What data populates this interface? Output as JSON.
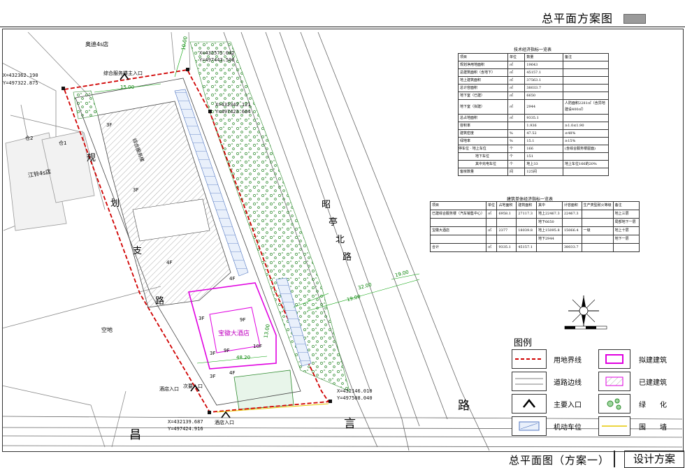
{
  "header": {
    "title": "总平面方案图"
  },
  "footer": {
    "title": "总平面图（方案一）",
    "box": "设计方案"
  },
  "tech_table": {
    "title": "技术经济指标一览表",
    "headers": [
      "项目",
      "单位",
      "数量",
      "备注"
    ],
    "rows": [
      [
        "规划净用地面积",
        "㎡",
        "19643",
        ""
      ],
      [
        "总建筑面积（含地下）",
        "㎡",
        "45157.1",
        ""
      ],
      [
        "地上建筑面积",
        "㎡",
        "37563.1",
        ""
      ],
      [
        "总计容面积",
        "㎡",
        "38033.7",
        ""
      ],
      [
        "地下室（已建）",
        "㎡",
        "6650",
        ""
      ],
      [
        "地下室（拟建）",
        "㎡",
        "2944",
        "人防面积2281㎡（含异地建设400㎡）"
      ],
      [
        "总占地面积",
        "㎡",
        "9335.1",
        ""
      ],
      [
        "容积率",
        "",
        "1.936",
        "≥1.0≤1.90"
      ],
      [
        "建筑密度",
        "%",
        "47.52",
        "≤48%"
      ],
      [
        "绿地率",
        "%",
        "15.1",
        "≥15%"
      ]
    ],
    "parking_label": "停车位",
    "parking_rows": [
      [
        "地上车位",
        "个",
        "166",
        "(含综合服务楼屋面)"
      ],
      [
        "地下车位",
        "个",
        "151",
        ""
      ],
      [
        "其中充电车位",
        "个",
        "地上33",
        "地上车位166的20%"
      ]
    ],
    "guest_row": [
      "客房数量",
      "间",
      "125间",
      ""
    ]
  },
  "building_table": {
    "title": "建筑单体经济指标一览表",
    "headers": [
      "项目",
      "单位",
      "占地面积",
      "建筑面积",
      "其中",
      "计容面积",
      "生产类型耐火等级",
      "备注"
    ],
    "rows": [
      [
        "已建综合服务楼（汽车销售中心）",
        "㎡",
        "6958.1",
        "27117.3",
        "地上22467.3",
        "22467.3",
        "",
        "地上三层"
      ],
      [
        "",
        "",
        "",
        "",
        "地下6650",
        "",
        "",
        "局部地下一层"
      ],
      [
        "宝徽大酒店",
        "㎡",
        "2377",
        "18039.8",
        "地上15095.8",
        "15066.4",
        "一级",
        "地上十层"
      ],
      [
        "",
        "",
        "",
        "",
        "地下2944",
        "",
        "",
        "地下一层"
      ],
      [
        "合计",
        "㎡",
        "9335.1",
        "45157.1",
        "",
        "38033.7",
        "",
        ""
      ]
    ]
  },
  "legend": {
    "title": "图例",
    "items": [
      {
        "label": "用地界线",
        "swatch": "boundary"
      },
      {
        "label": "拟建建筑",
        "swatch": "proposed"
      },
      {
        "label": "道路边线",
        "swatch": "road"
      },
      {
        "label": "已建建筑",
        "swatch": "existing"
      },
      {
        "label": "主要入口",
        "swatch": "entrance"
      },
      {
        "label": "绿　　化",
        "swatch": "green"
      },
      {
        "label": "机动车位",
        "swatch": "parking"
      },
      {
        "label": "围　　墙",
        "swatch": "wall"
      }
    ]
  },
  "map": {
    "roads": {
      "west": [
        "规",
        "划",
        "支",
        "路"
      ],
      "north_east": [
        "昭",
        "亭",
        "北",
        "路"
      ],
      "south": [
        "昌",
        "言",
        "路"
      ]
    },
    "labels": {
      "audi": "奥迪4s店",
      "jac": "江铃4s店",
      "empty_lot": "空地",
      "hotel": "宝徽大酒店",
      "service_entrance": "综合服务楼主入口",
      "hotel_entrance": "酒店入口",
      "side_entrance": "次要入口",
      "hotel_entrance2": "酒店入口",
      "existing_bldg": "综合服务楼",
      "warehouse1": "仓1",
      "warehouse2": "仓2",
      "floors": [
        "3F",
        "3F",
        "4F",
        "3F",
        "3F",
        "4F",
        "10F",
        "9F",
        "9F",
        "4F",
        "3F"
      ]
    },
    "coords": [
      "X=432362.190",
      "Y=497322.875",
      "X=432575.042",
      "Y=497443.506",
      "X=432342.121",
      "Y=497423.604",
      "X=432139.687",
      "Y=497424.916",
      "X=432146.010",
      "Y=497508.040"
    ],
    "dims": [
      "15.00",
      "19.00",
      "32.00",
      "19.00",
      "10.00",
      "48.20",
      "13.00"
    ]
  },
  "colors": {
    "boundary": "#d00000",
    "proposed": "#e000e0",
    "green": "#2d8a2d",
    "road": "#555555",
    "parking": "#3060c0",
    "dimension": "#00a000",
    "yellow_wall": "#e6c700"
  }
}
